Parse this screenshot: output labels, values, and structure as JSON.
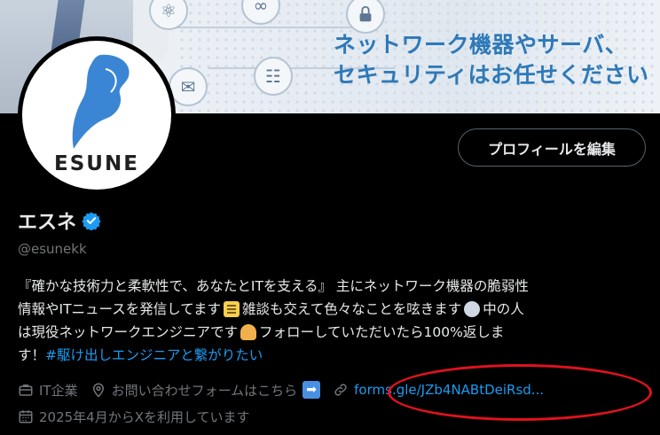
{
  "banner": {
    "headline_line1": "ネットワーク機器やサーバ、",
    "headline_line2": "セキュリティはお任せください"
  },
  "avatar": {
    "wordmark": "ESUNE"
  },
  "profile": {
    "edit_button_label": "プロフィールを編集",
    "display_name": "エスネ",
    "handle": "@esunekk",
    "bio_lines": [
      "『確かな技術力と柔軟性で、あなたとITを支える』 主にネットワーク機器の脆弱性",
      "情報やITニュースを発信してます",
      " 雑談も交えて色々なことを呟きます",
      " 中の人",
      "は現役ネットワークエンジニアです",
      " フォローしていただいたら100%返しま",
      "す！",
      "#駆け出しエンジニアと繋がりたい"
    ],
    "category": "IT企業",
    "location": "お問い合わせフォームはこちら",
    "website": "forms.gle/JZb4NABtDeiRsd...",
    "joined": "2025年4月からXを利用しています"
  },
  "colors": {
    "accent": "#1d9bf0",
    "banner_text": "#2e79b8",
    "logo_blue": "#3a86d4",
    "annotation_red": "#e0121d"
  },
  "icons": [
    "lock-icon",
    "email-icon",
    "network-icon",
    "verified-badge-icon",
    "briefcase-icon",
    "location-pin-icon",
    "link-icon",
    "calendar-icon"
  ]
}
